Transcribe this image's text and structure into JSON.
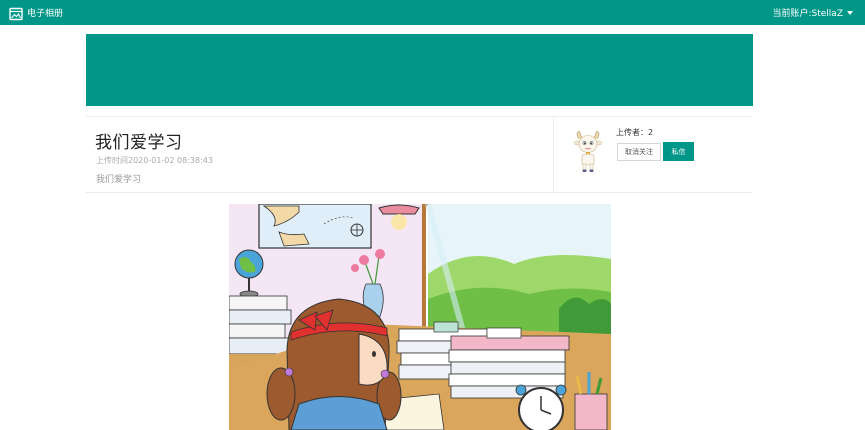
{
  "navbar": {
    "brand_icon": "album-icon",
    "brand_text": "电子相册",
    "account_label": "当前账户:StellaZ",
    "account_caret_icon": "caret-down-icon",
    "background_color": "#009688"
  },
  "banner": {
    "background_color": "#009688"
  },
  "album": {
    "title": "我们爱学习",
    "upload_time": "上传时间2020-01-02 08:38:43",
    "description": "我们爱学习"
  },
  "uploader": {
    "label": "上传者：2",
    "avatar_icon": "goat-avatar",
    "unfollow_label": "取消关注",
    "message_label": "私信"
  },
  "photo": {
    "subject": "cartoon-girl-studying"
  },
  "colors": {
    "accent": "#009688",
    "text_muted": "#999999"
  }
}
